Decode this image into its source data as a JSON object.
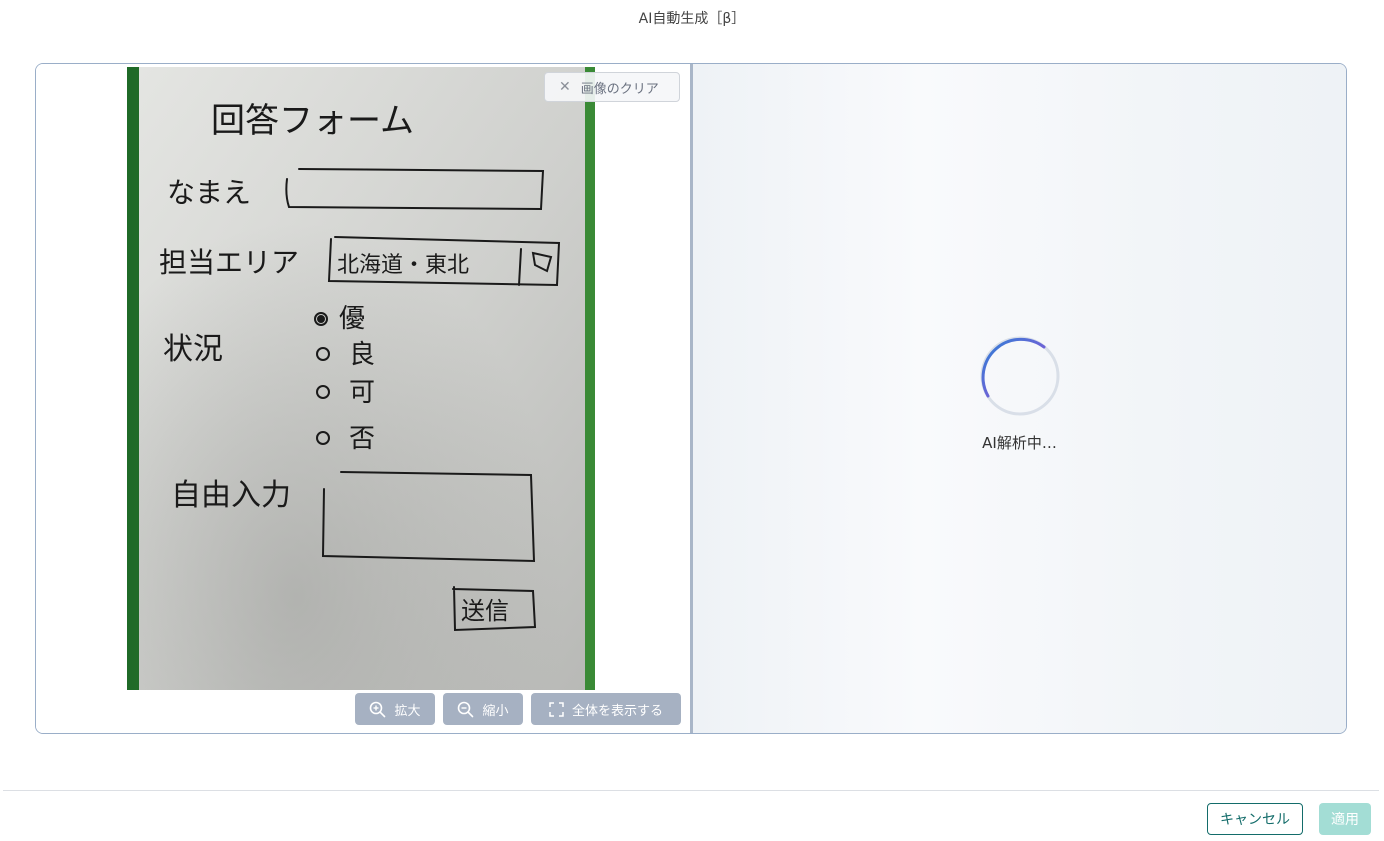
{
  "dialog": {
    "title": "AI自動生成［β］"
  },
  "image_viewer": {
    "clear_label": "画像のクリア",
    "zoom_in_label": "拡大",
    "zoom_out_label": "縮小",
    "fit_label": "全体を表示する",
    "sketch": {
      "title": "回答フォーム",
      "name_label": "なまえ",
      "area_label": "担当エリア",
      "area_value": "北海道・東北",
      "status_label": "状況",
      "options": [
        "優",
        "良",
        "可",
        "否"
      ],
      "free_label": "自由入力",
      "submit_label": "送信"
    }
  },
  "analysis": {
    "status_text": "AI解析中…"
  },
  "footer": {
    "cancel_label": "キャンセル",
    "apply_label": "適用"
  }
}
